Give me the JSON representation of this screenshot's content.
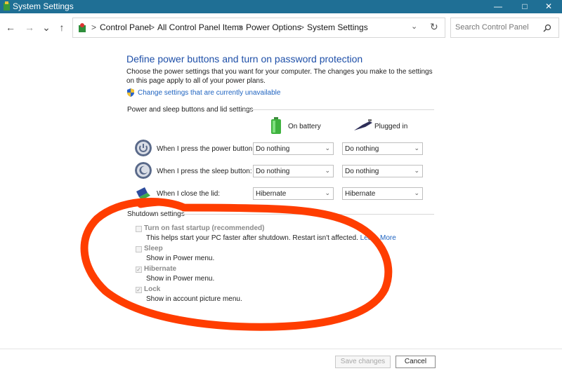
{
  "window": {
    "title": "System Settings",
    "minimize": "—",
    "maximize": "□",
    "close": "✕"
  },
  "nav": {
    "back": "←",
    "forward": "→",
    "recent": "⌄",
    "up": "↑"
  },
  "address": {
    "crumbs": [
      "Control Panel",
      "All Control Panel Items",
      "Power Options",
      "System Settings"
    ],
    "separator": ">",
    "dropdown": "⌄",
    "refresh": "↻"
  },
  "search": {
    "placeholder": "Search Control Panel",
    "icon": "search-icon"
  },
  "page": {
    "heading": "Define power buttons and turn on password protection",
    "description": "Choose the power settings that you want for your computer. The changes you make to the settings on this page apply to all of your power plans.",
    "change_link": "Change settings that are currently unavailable"
  },
  "power_section": {
    "title": "Power and sleep buttons and lid settings",
    "on_battery": "On battery",
    "plugged_in": "Plugged in",
    "rows": [
      {
        "label": "When I press the power button:",
        "battery": "Do nothing",
        "plugged": "Do nothing"
      },
      {
        "label": "When I press the sleep button:",
        "battery": "Do nothing",
        "plugged": "Do nothing"
      },
      {
        "label": "When I close the lid:",
        "battery": "Hibernate",
        "plugged": "Hibernate"
      }
    ]
  },
  "shutdown_section": {
    "title": "Shutdown settings",
    "items": [
      {
        "label": "Turn on fast startup (recommended)",
        "desc": "This helps start your PC faster after shutdown. Restart isn't affected.",
        "link": "Learn More",
        "checked": false
      },
      {
        "label": "Sleep",
        "desc": "Show in Power menu.",
        "checked": false
      },
      {
        "label": "Hibernate",
        "desc": "Show in Power menu.",
        "checked": true
      },
      {
        "label": "Lock",
        "desc": "Show in account picture menu.",
        "checked": true
      }
    ]
  },
  "footer": {
    "save": "Save changes",
    "cancel": "Cancel"
  },
  "colors": {
    "titlebar": "#1f6f95",
    "heading": "#1e4fa8",
    "link": "#1e63c0",
    "annotation": "#ff3d00"
  }
}
